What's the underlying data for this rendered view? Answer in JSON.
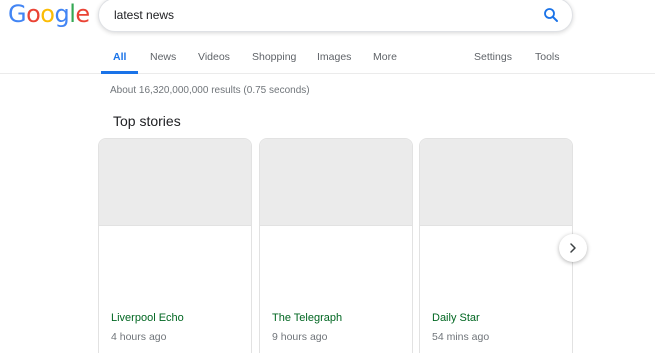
{
  "logo": {
    "letters": [
      {
        "ch": "G",
        "color": "#4285F4"
      },
      {
        "ch": "o",
        "color": "#EA4335"
      },
      {
        "ch": "o",
        "color": "#FBBC05"
      },
      {
        "ch": "g",
        "color": "#4285F4"
      },
      {
        "ch": "l",
        "color": "#34A853"
      },
      {
        "ch": "e",
        "color": "#EA4335"
      }
    ]
  },
  "search": {
    "value": "latest news",
    "icon": "search-icon"
  },
  "tabs": {
    "all": "All",
    "news": "News",
    "videos": "Videos",
    "shopping": "Shopping",
    "images": "Images",
    "more": "More",
    "settings": "Settings",
    "tools": "Tools"
  },
  "stats": "About 16,320,000,000 results (0.75 seconds)",
  "top_stories": {
    "title": "Top stories",
    "cards": [
      {
        "source": "Liverpool Echo",
        "time": "4 hours ago"
      },
      {
        "source": "The Telegraph",
        "time": "9 hours ago"
      },
      {
        "source": "Daily Star",
        "time": "54 mins ago"
      }
    ],
    "next_icon": "chevron-right-icon"
  },
  "colors": {
    "accent": "#1a73e8",
    "source_green": "#006621",
    "placeholder_gray": "#ebebeb"
  }
}
